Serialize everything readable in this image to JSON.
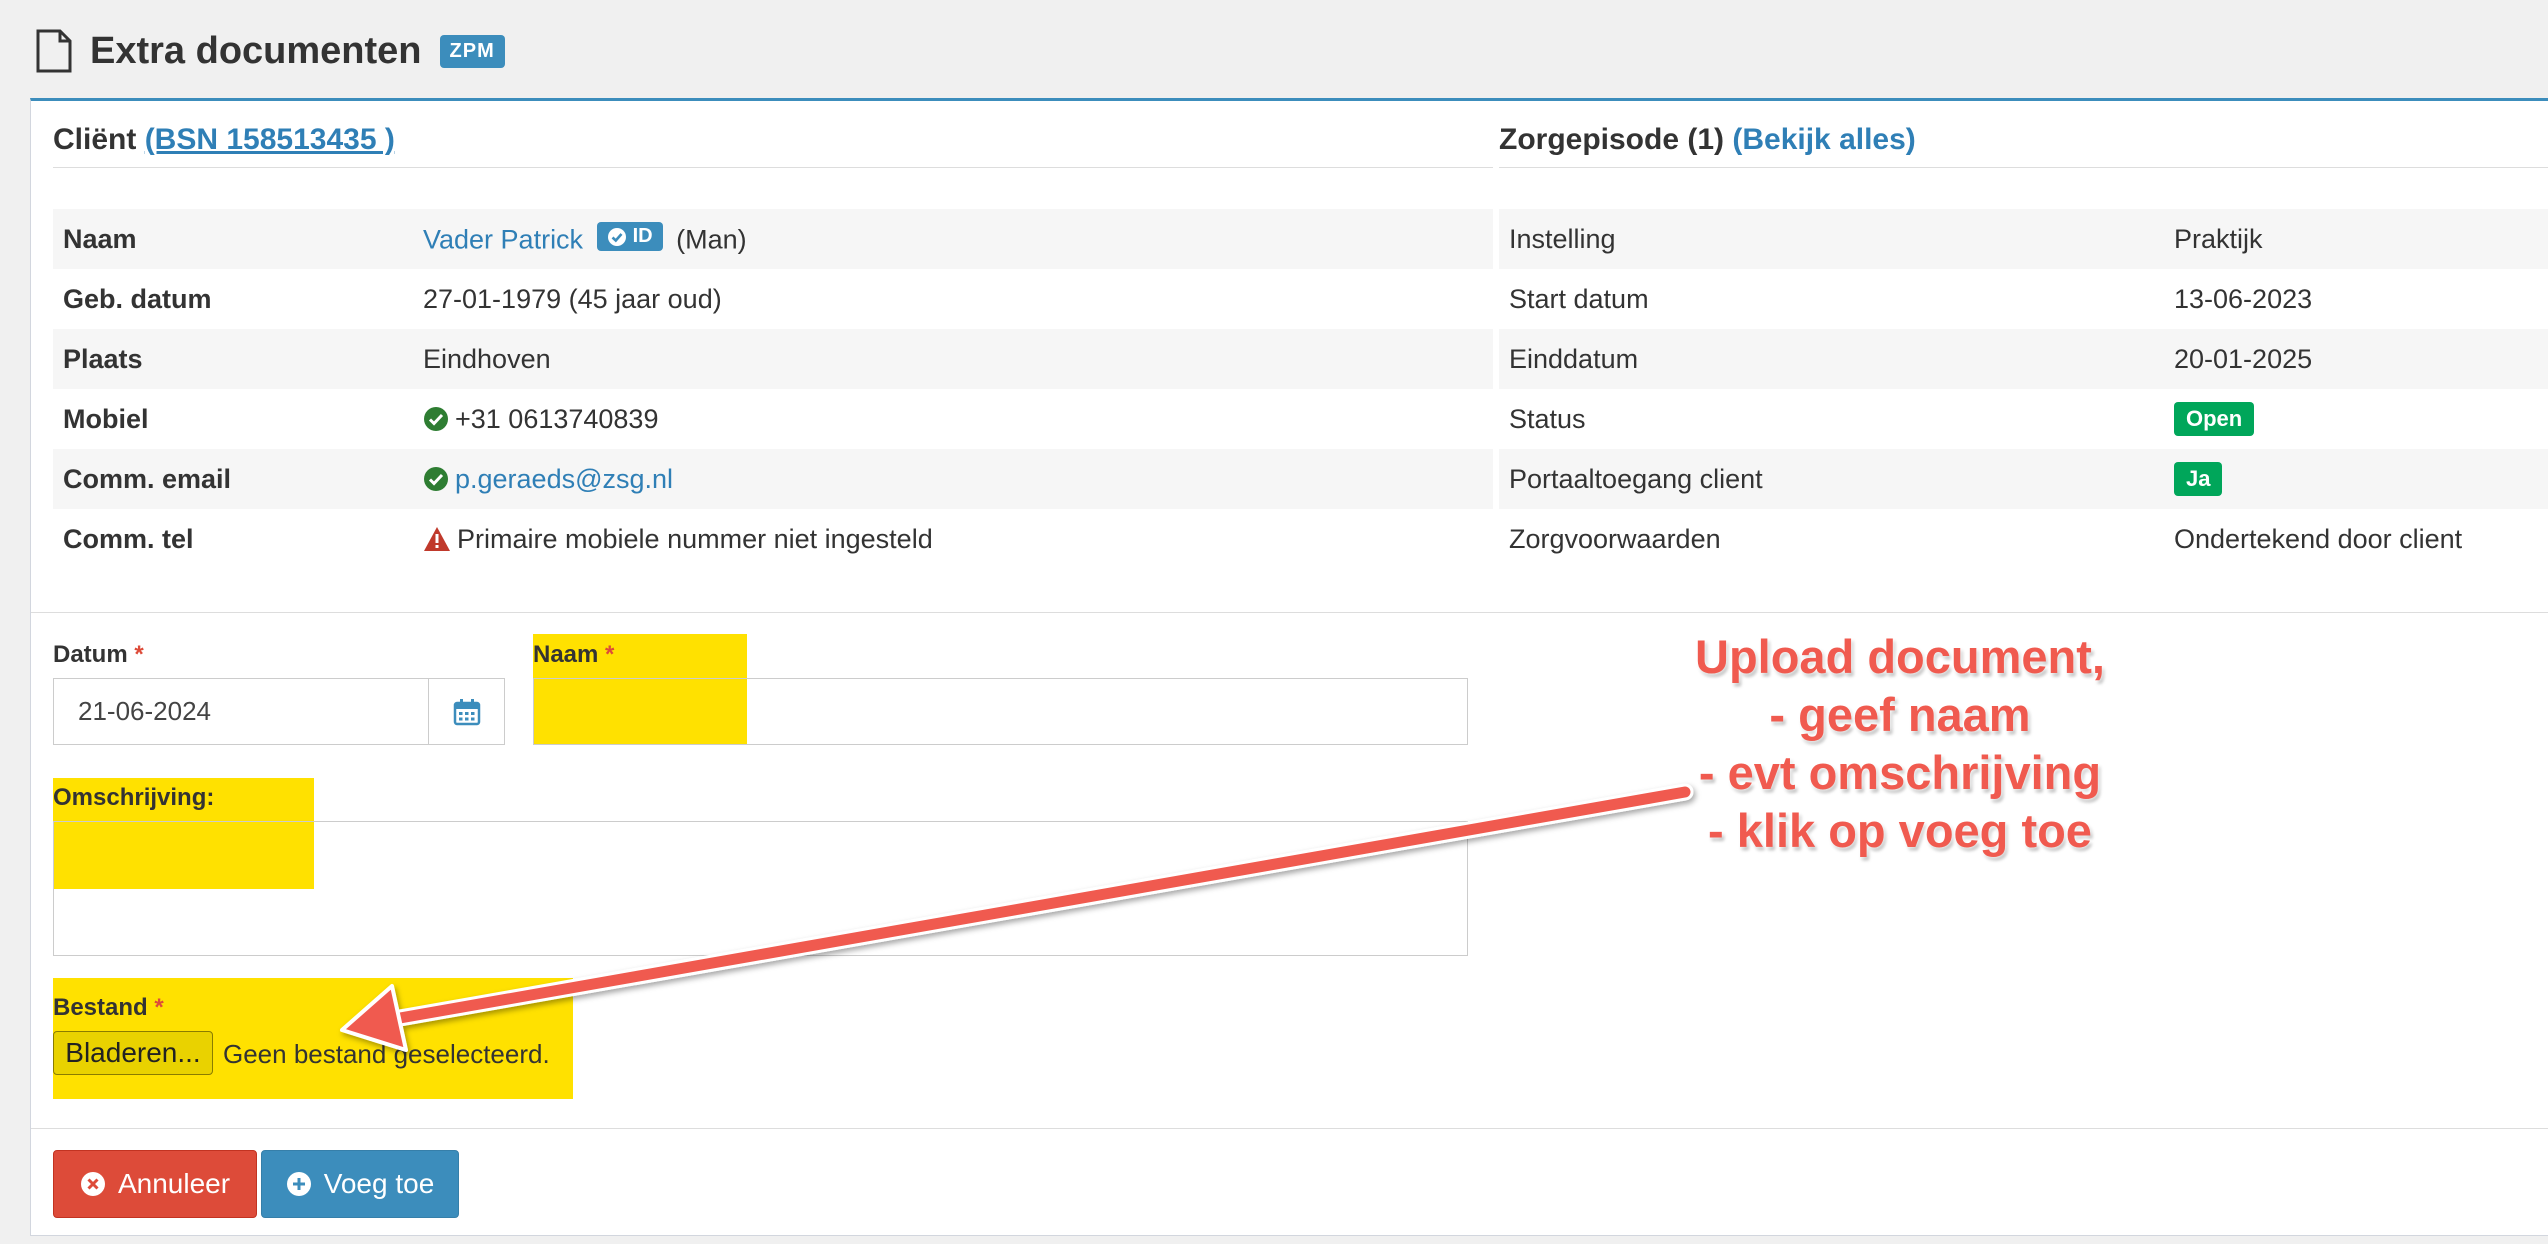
{
  "page": {
    "title": "Extra documenten",
    "badge": "ZPM"
  },
  "client": {
    "heading": "Cliënt",
    "bsn_link": "(BSN 158513435 )",
    "rows": [
      {
        "label": "Naam",
        "value": "Vader Patrick",
        "id_badge": "ID",
        "suffix": "(Man)"
      },
      {
        "label": "Geb. datum",
        "value": "27-01-1979 (45 jaar oud)"
      },
      {
        "label": "Plaats",
        "value": "Eindhoven"
      },
      {
        "label": "Mobiel",
        "value": "+31 0613740839"
      },
      {
        "label": "Comm. email",
        "value": "p.geraeds@zsg.nl"
      },
      {
        "label": "Comm. tel",
        "value": "Primaire mobiele nummer niet ingesteld"
      }
    ]
  },
  "episode": {
    "heading": "Zorgepisode (1)",
    "view_all": "(Bekijk alles)",
    "rows": [
      {
        "label": "Instelling",
        "value": "Praktijk"
      },
      {
        "label": "Start datum",
        "value": "13-06-2023"
      },
      {
        "label": "Einddatum",
        "value": "20-01-2025"
      },
      {
        "label": "Status",
        "value": "Open"
      },
      {
        "label": "Portaaltoegang client",
        "value": "Ja"
      },
      {
        "label": "Zorgvoorwaarden",
        "value": "Ondertekend door client"
      }
    ]
  },
  "form": {
    "datum_label": "Datum",
    "datum_value": "21-06-2024",
    "naam_label": "Naam",
    "naam_value": "",
    "omschrijving_label": "Omschrijving:",
    "omschrijving_value": "",
    "bestand_label": "Bestand",
    "browse_label": "Bladeren...",
    "file_status": "Geen bestand geselecteerd.",
    "required_mark": "*"
  },
  "actions": {
    "cancel": "Annuleer",
    "add": "Voeg toe"
  },
  "annotation": {
    "lines": [
      "Upload document,",
      "- geef naam",
      "- evt omschrijving",
      "- klik op voeg toe"
    ]
  },
  "colors": {
    "primary": "#3c8dbc",
    "danger": "#dd4b39",
    "success": "#00a65a",
    "highlight": "#ffe100",
    "annotation": "#f05a4f"
  }
}
